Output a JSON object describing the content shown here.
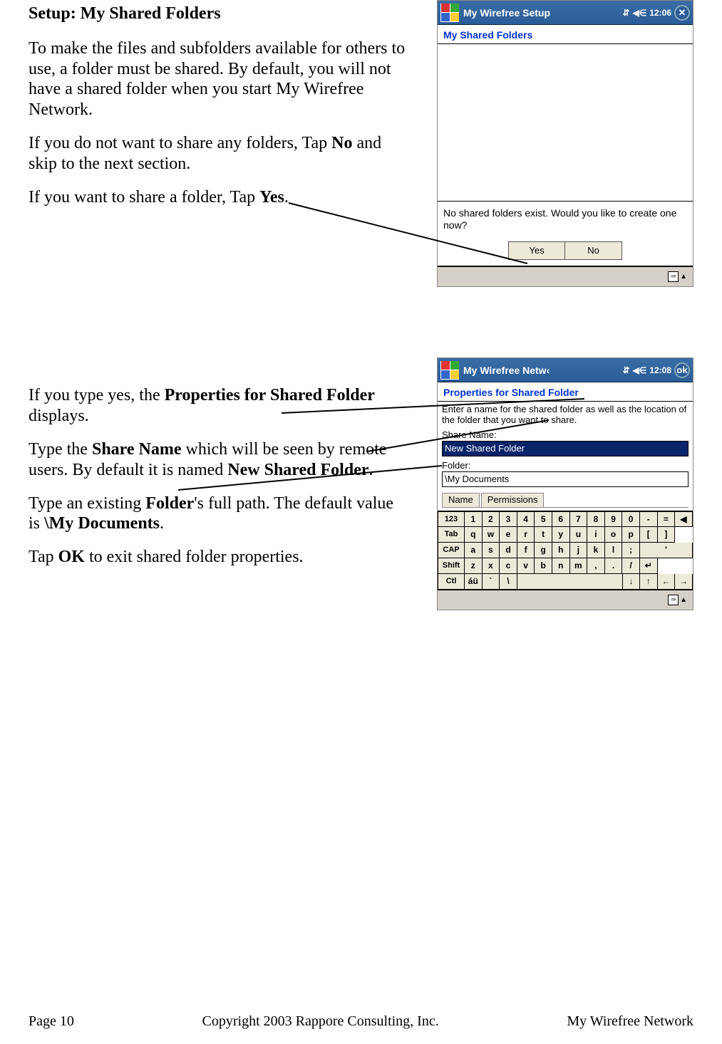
{
  "heading": "Setup: My Shared Folders",
  "para1": "To make the files and subfolders available for others to use, a folder must be shared. By default, you will not have a shared folder when you start My Wirefree Network.",
  "para2a": "If you do not want to share any folders, Tap ",
  "para2b": "No",
  "para2c": " and skip to the next section.",
  "para3a": "If you want to share a folder, Tap ",
  "para3b": "Yes",
  "para3c": ".",
  "para4a": "If you type yes, the ",
  "para4b": "Properties for Shared Folder",
  "para4c": " displays.",
  "para5a": "Type the ",
  "para5b": "Share Name",
  "para5c": " which will be seen by remote users.  By default it is named ",
  "para5d": "New Shared Folder",
  "para5e": ".",
  "para6a": "Type an existing ",
  "para6b": "Folder",
  "para6c": "'s full path. The default value is ",
  "para6d": "\\My Documents",
  "para6e": ".",
  "para7a": "Tap ",
  "para7b": "OK",
  "para7c": " to exit shared folder properties.",
  "shot1": {
    "title": "My Wirefree Setup",
    "time": "12:06",
    "close_glyph": "✕",
    "subhead": "My Shared Folders",
    "dialog_text": "No shared folders exist.  Would you like to create one now?",
    "yes": "Yes",
    "no": "No"
  },
  "shot2": {
    "title": "My Wirefree Netw‹",
    "time": "12:08",
    "ok": "ok",
    "subhead": "Properties for Shared Folder",
    "instruct": "Enter a name for the shared folder as well as the location of the folder that you want to share.",
    "share_label": "Share Name:",
    "share_value": "New Shared Folder",
    "folder_label": "Folder:",
    "folder_value": "\\My Documents",
    "tab1": "Name",
    "tab2": "Permissions"
  },
  "osk": {
    "r1": [
      "123",
      "1",
      "2",
      "3",
      "4",
      "5",
      "6",
      "7",
      "8",
      "9",
      "0",
      "-",
      "=",
      "◀"
    ],
    "r2": [
      "Tab",
      "q",
      "w",
      "e",
      "r",
      "t",
      "y",
      "u",
      "i",
      "o",
      "p",
      "[",
      "]"
    ],
    "r3": [
      "CAP",
      "a",
      "s",
      "d",
      "f",
      "g",
      "h",
      "j",
      "k",
      "l",
      ";",
      "'"
    ],
    "r4": [
      "Shift",
      "z",
      "x",
      "c",
      "v",
      "b",
      "n",
      "m",
      ",",
      ".",
      "/",
      "↵"
    ],
    "r5": [
      "Ctl",
      "áü",
      "`",
      "\\",
      "",
      "↓",
      "↑",
      "←",
      "→"
    ]
  },
  "footer": {
    "left": "Page 10",
    "center": "Copyright 2003 Rappore Consulting, Inc.",
    "right": "My Wirefree Network"
  }
}
